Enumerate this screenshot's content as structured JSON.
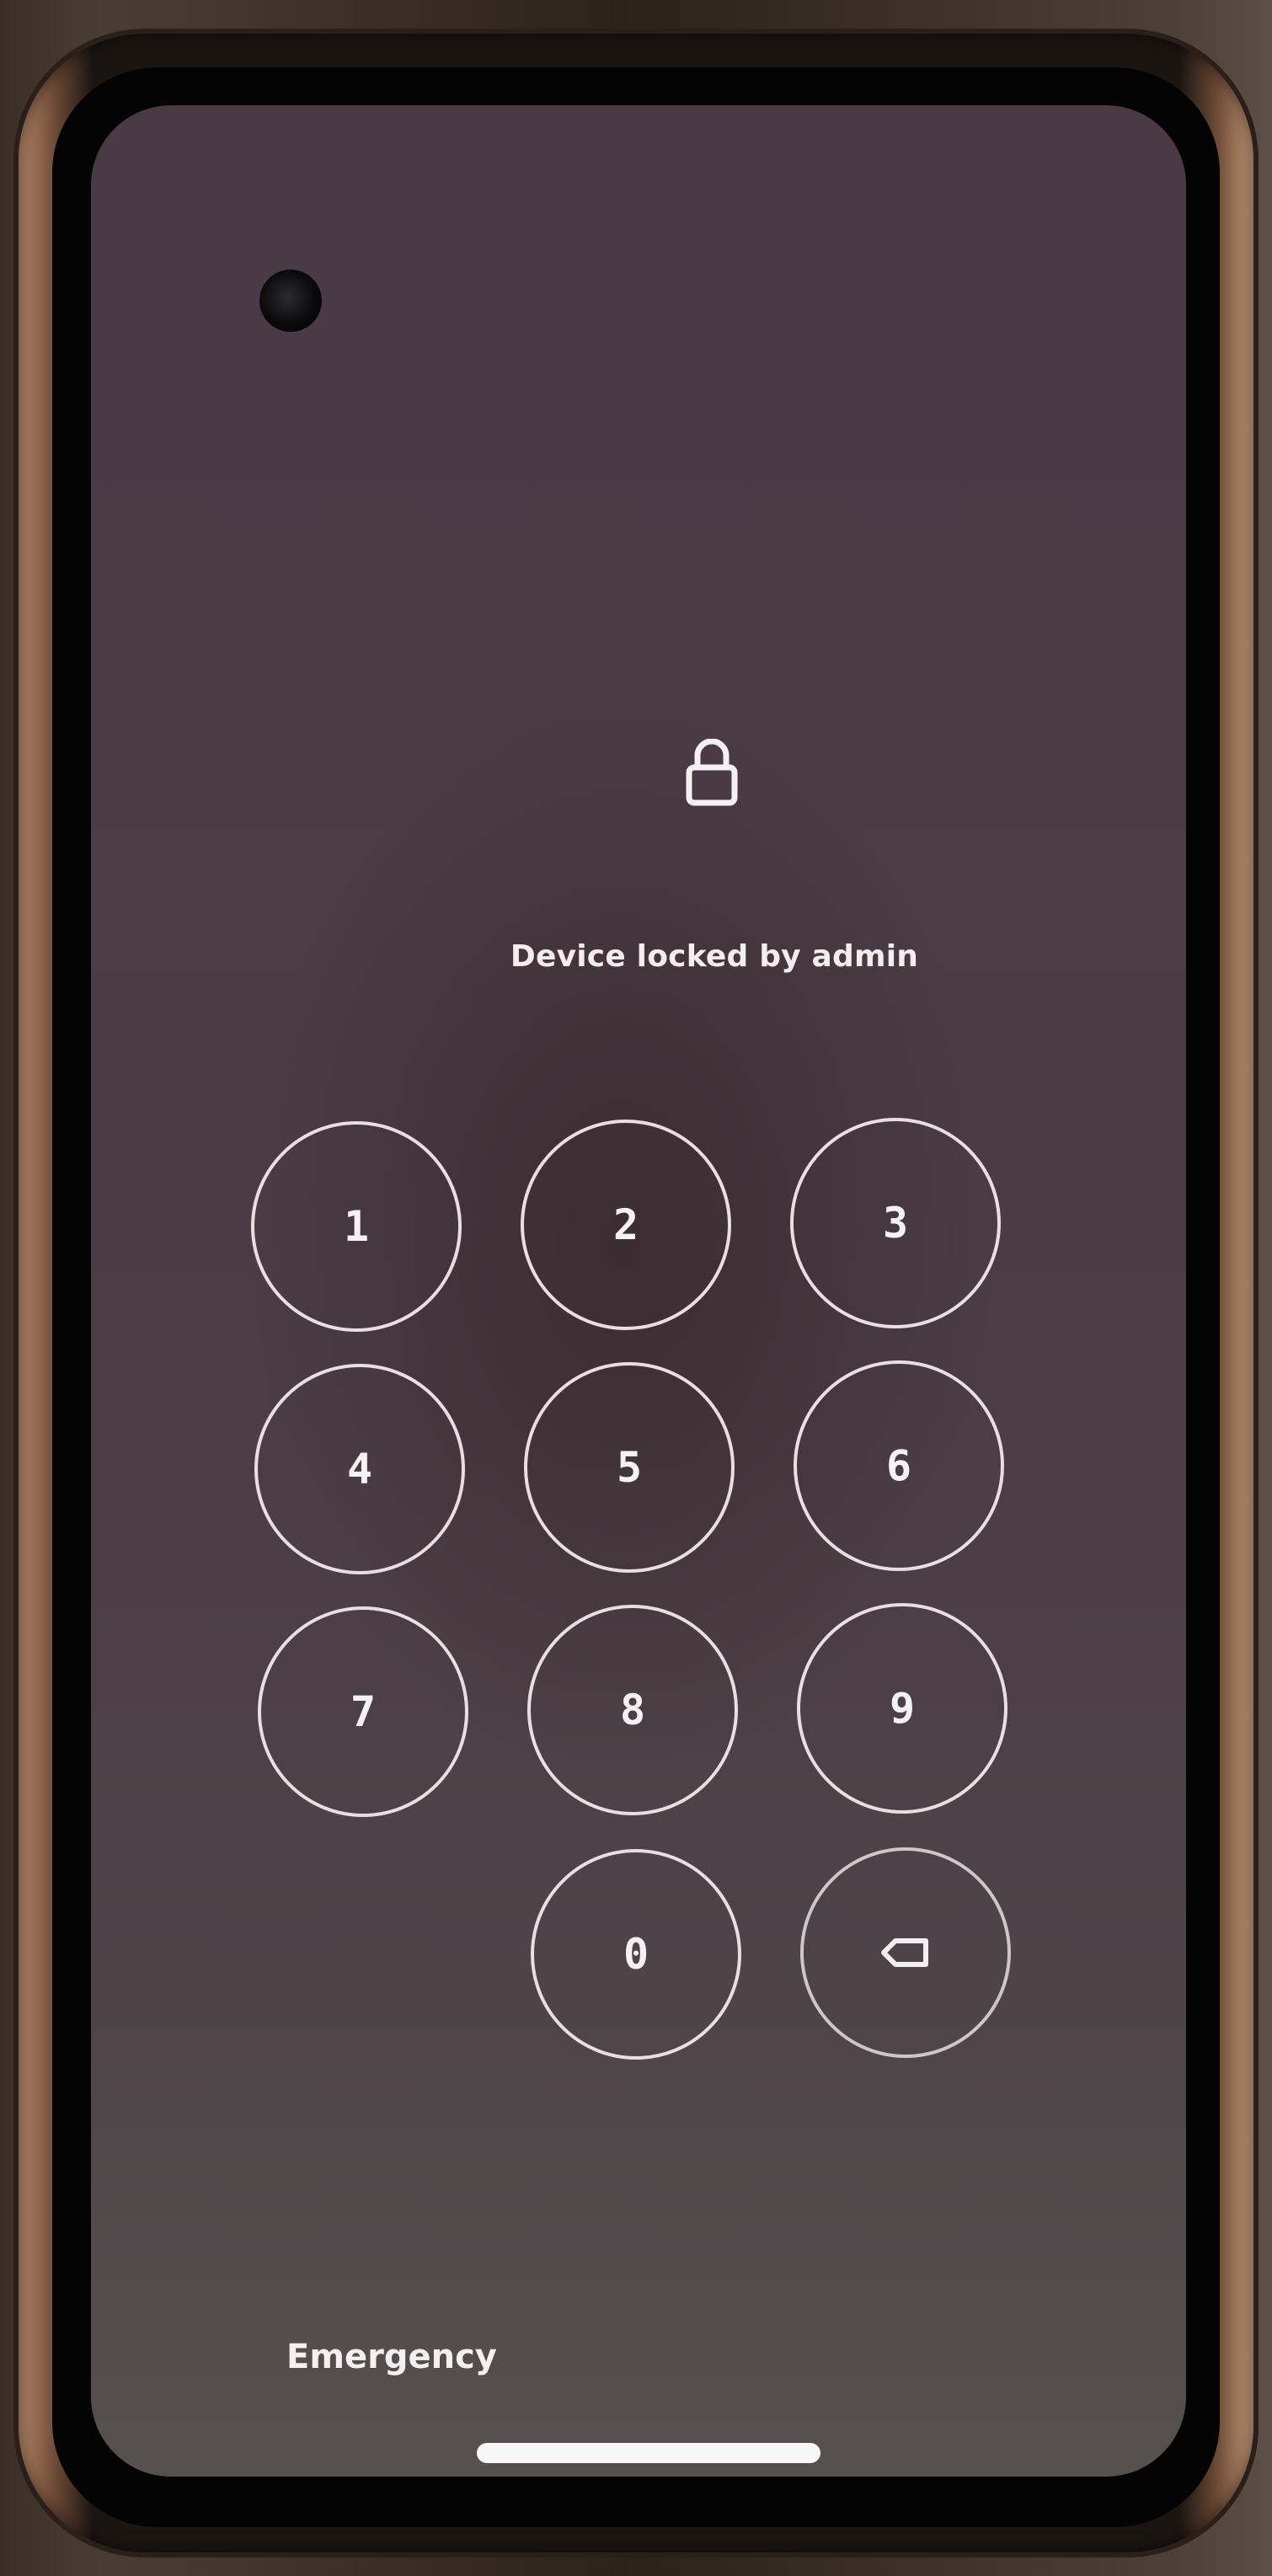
{
  "lock_screen": {
    "icon": "lock-icon",
    "message": "Device locked by admin",
    "keypad": {
      "keys": [
        "1",
        "2",
        "3",
        "4",
        "5",
        "6",
        "7",
        "8",
        "9",
        "0"
      ],
      "backspace_icon": "backspace-icon"
    },
    "emergency_label": "Emergency"
  },
  "colors": {
    "screen_bg": "#4a3a45",
    "text": "#f3eded",
    "key_outline": "#e9dfe3"
  }
}
